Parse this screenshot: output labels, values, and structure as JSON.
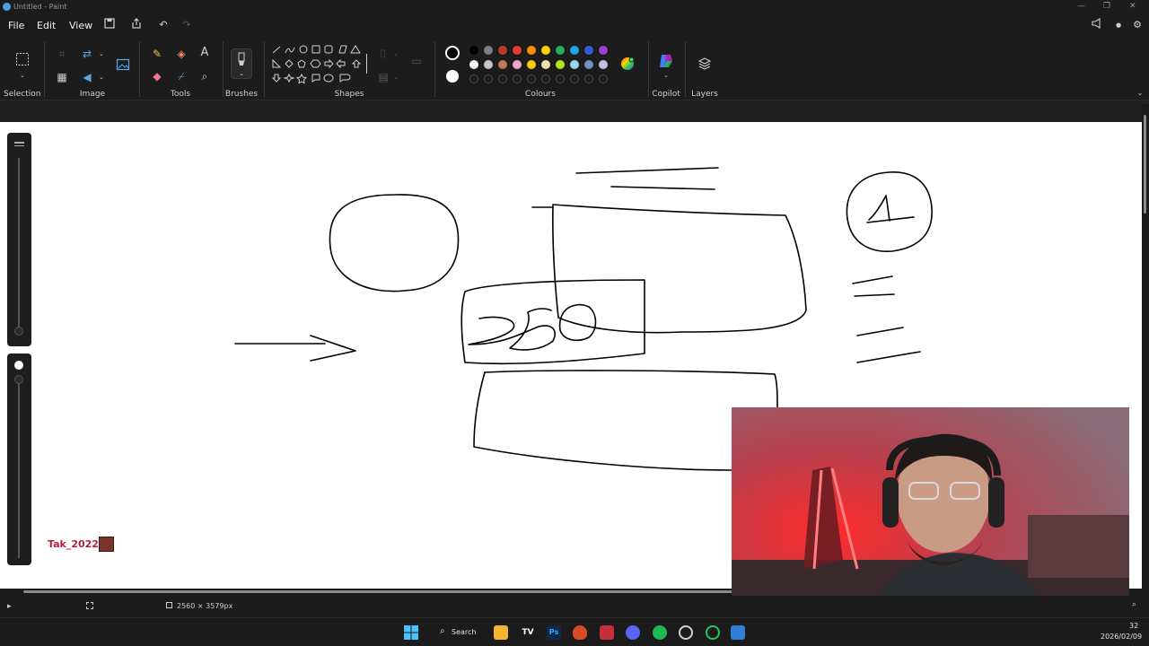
{
  "window": {
    "title": "Untitled - Paint"
  },
  "menu": {
    "file": "File",
    "edit": "Edit",
    "view": "View"
  },
  "ribbon": {
    "groups": {
      "selection": "Selection",
      "image": "Image",
      "tools": "Tools",
      "brushes": "Brushes",
      "shapes": "Shapes",
      "colours": "Colours",
      "copilot": "Copilot",
      "layers": "Layers"
    },
    "text_tool_glyph": "A"
  },
  "palette": {
    "primary": "#000000",
    "secondary": "#ffffff",
    "row1": [
      "#000000",
      "#808080",
      "#c0392b",
      "#e53935",
      "#ff8c00",
      "#ffd400",
      "#27ae60",
      "#1ea7e6",
      "#2f5dd6",
      "#9b3fd1"
    ],
    "row2": [
      "#ffffff",
      "#c8c8c8",
      "#b97a57",
      "#f4a7c4",
      "#ffc90e",
      "#efe4b0",
      "#b5e61d",
      "#99d9ea",
      "#7092be",
      "#c8bfe7"
    ]
  },
  "status": {
    "canvas_size": "2560 × 3579px"
  },
  "watermark": {
    "text": "Tak_2022"
  },
  "taskbar": {
    "search": "Search",
    "time": "32",
    "date": "2026/02/09"
  }
}
